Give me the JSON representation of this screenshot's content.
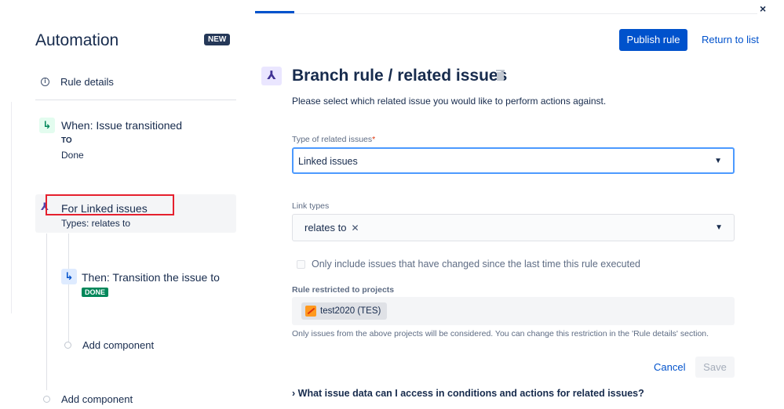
{
  "window": {
    "close_glyph": "×"
  },
  "sidebar": {
    "title": "Automation",
    "badge": "NEW",
    "rule_details": {
      "icon": "info-icon",
      "label": "Rule details"
    },
    "trigger": {
      "icon": "trigger-icon",
      "title": "When: Issue transitioned",
      "to_label": "TO",
      "to_value": "Done"
    },
    "branch": {
      "icon": "branch-icon",
      "title": "For Linked issues",
      "subtitle": "Types: relates to"
    },
    "action": {
      "icon": "transition-icon",
      "title": "Then: Transition the issue to",
      "status": "DONE"
    },
    "add_component_inner": "Add component",
    "add_component_outer": "Add component"
  },
  "header": {
    "publish_label": "Publish rule",
    "return_label": "Return to list"
  },
  "panel": {
    "icon": "branch-icon",
    "title": "Branch rule / related issues",
    "description": "Please select which related issue you would like to perform actions against.",
    "type_label": "Type of related issues",
    "required_marker": "*",
    "type_value": "Linked issues",
    "link_types_label": "Link types",
    "link_types_chip": "relates to",
    "checkbox_label": "Only include issues that have changed since the last time this rule executed",
    "checkbox_checked": false,
    "projects_label": "Rule restricted to projects",
    "project_chip": "test2020 (TES)",
    "help_text": "Only issues from the above projects will be considered. You can change this restriction in the 'Rule details' section.",
    "cancel_label": "Cancel",
    "save_label": "Save",
    "expander_label": "What issue data can I access in conditions and actions for related issues?"
  },
  "colors": {
    "accent": "#0052cc",
    "success": "#00875a",
    "highlight_box": "#e5202e"
  }
}
